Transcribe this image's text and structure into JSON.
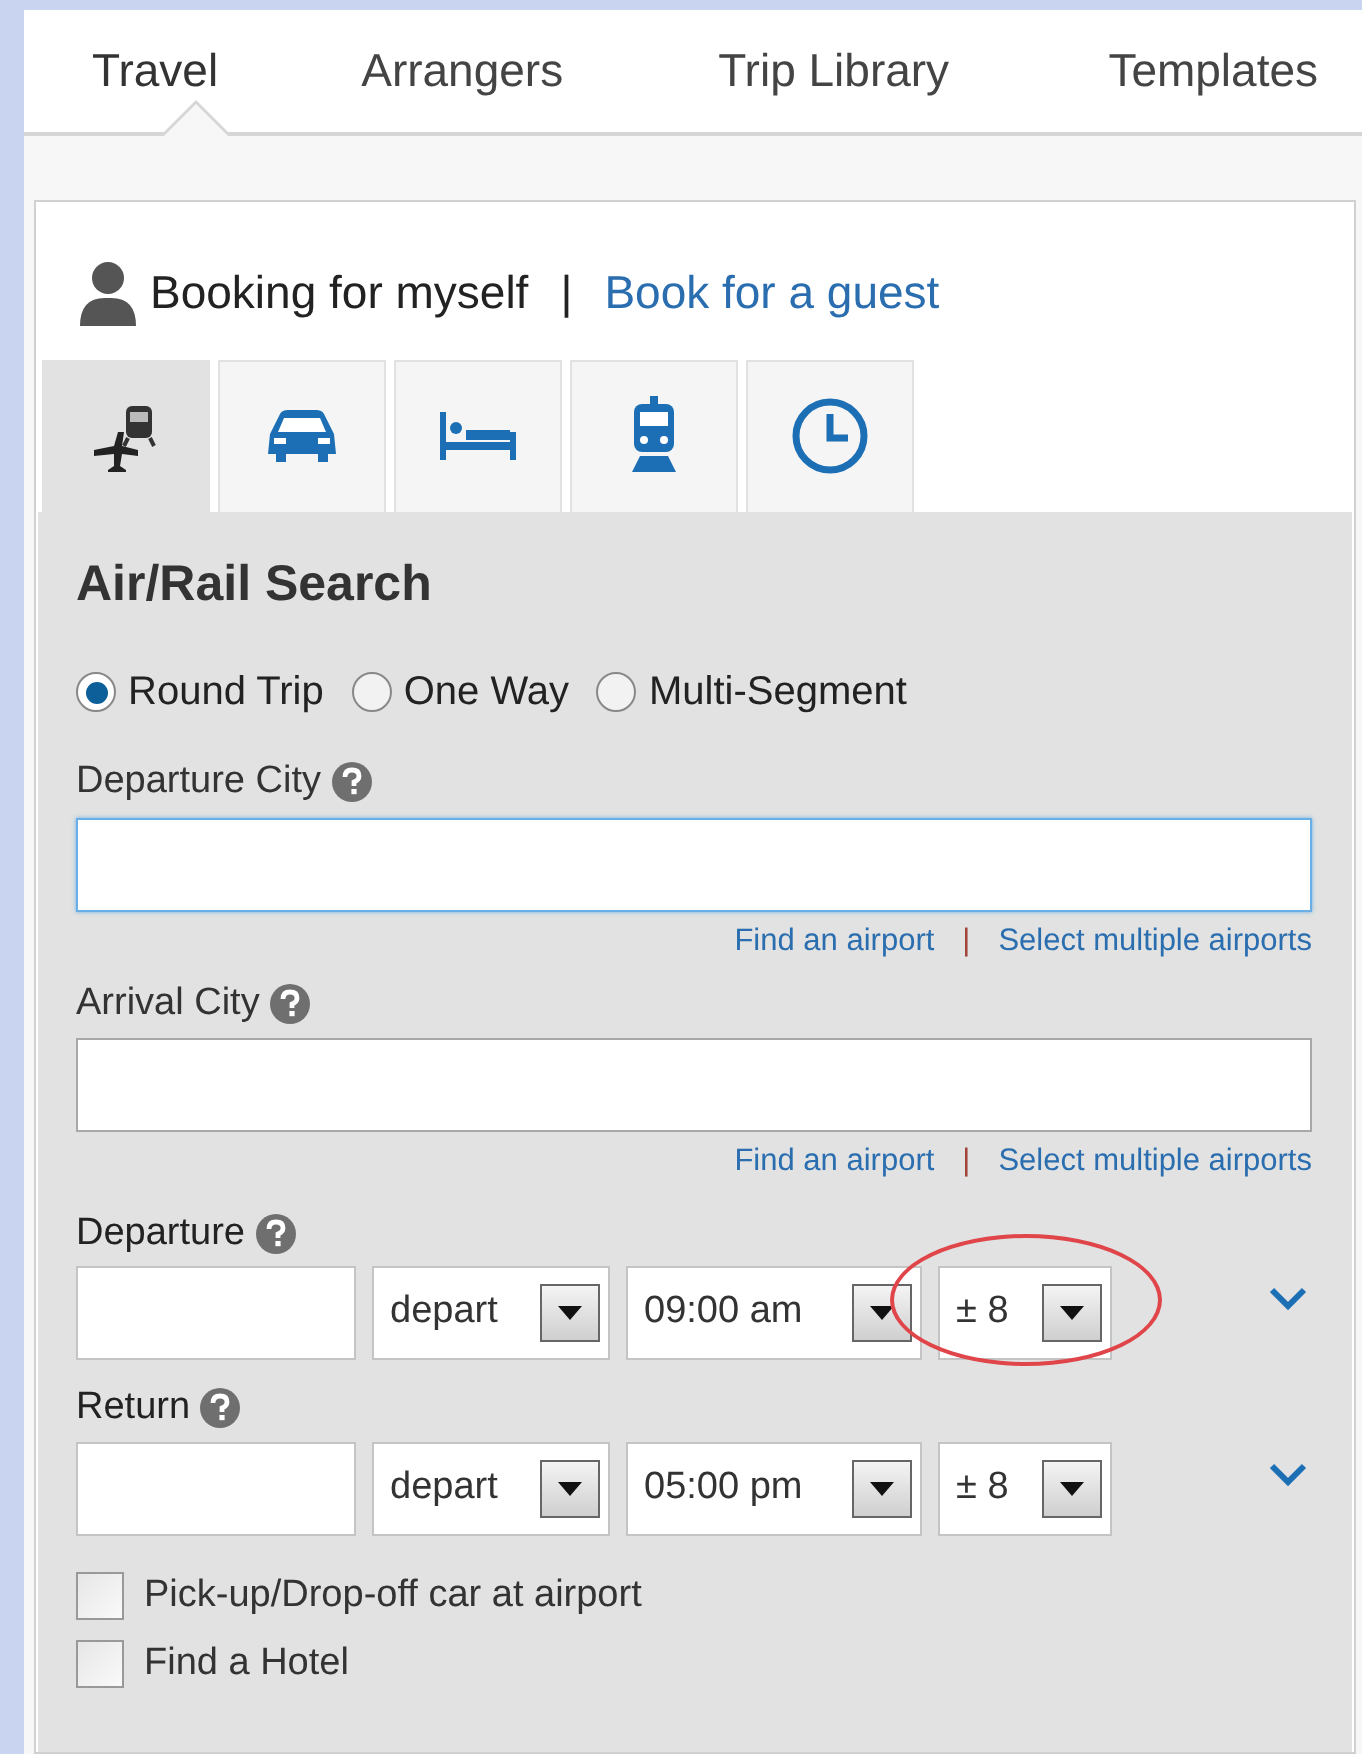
{
  "nav_tabs": [
    {
      "label": "Travel",
      "selected": true
    },
    {
      "label": "Arrangers",
      "selected": false
    },
    {
      "label": "Trip Library",
      "selected": false
    },
    {
      "label": "Templates",
      "selected": false
    }
  ],
  "booking": {
    "self_label": "Booking for myself",
    "separator": "|",
    "guest_link": "Book for a guest"
  },
  "mode_tabs": [
    {
      "kind": "air-rail",
      "selected": true
    },
    {
      "kind": "car",
      "selected": false
    },
    {
      "kind": "hotel",
      "selected": false
    },
    {
      "kind": "rail",
      "selected": false
    },
    {
      "kind": "recent",
      "selected": false
    }
  ],
  "search": {
    "title": "Air/Rail Search",
    "trip_types": [
      {
        "label": "Round Trip",
        "selected": true
      },
      {
        "label": "One Way",
        "selected": false
      },
      {
        "label": "Multi-Segment",
        "selected": false
      }
    ],
    "cities": [
      {
        "label": "Departure City",
        "focused": true,
        "links": [
          "Find an airport",
          "Select multiple airports"
        ],
        "separator": "|"
      },
      {
        "label": "Arrival City",
        "focused": false,
        "links": [
          "Find an airport",
          "Select multiple airports"
        ],
        "separator": "|"
      }
    ],
    "dates": [
      {
        "label": "Departure",
        "mode": "depart",
        "time": "09:00 am",
        "window": "± 8",
        "circled": true
      },
      {
        "label": "Return",
        "mode": "depart",
        "time": "05:00 pm",
        "window": "± 8",
        "circled": false
      }
    ],
    "options": [
      {
        "label": "Pick-up/Drop-off car at airport",
        "checked": false
      },
      {
        "label": "Find a Hotel",
        "checked": false
      }
    ]
  }
}
